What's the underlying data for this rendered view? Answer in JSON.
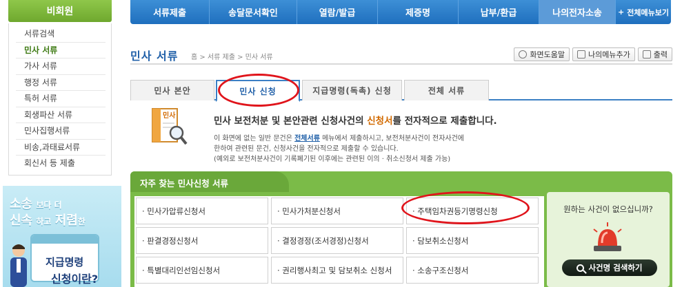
{
  "sidebar": {
    "header": "비회원",
    "items": [
      "서류검색",
      "민사 서류",
      "가사 서류",
      "행정 서류",
      "특허 서류",
      "회생파산 서류",
      "민사집행서류",
      "비송,과태료서류",
      "회신서 등 제출"
    ],
    "active_index": 1
  },
  "banner": {
    "line1_a": "소송",
    "line1_b": "보다 더",
    "line2_a": "신속",
    "line2_b": "하고",
    "line2_c": "저렴",
    "line2_d": "한",
    "line3": "지급명령",
    "line4": "신청이란?"
  },
  "topnav": {
    "items": [
      "서류제출",
      "송달문서확인",
      "열람/발급",
      "제증명",
      "납부/환급",
      "나의전자소송"
    ],
    "all_menu": "전체메뉴보기",
    "all_menu_icon": "plus-icon"
  },
  "page": {
    "title": "민사 서류",
    "breadcrumb": "홈 > 서류 제출 > 민사 서류"
  },
  "tools": {
    "help": "화면도움말",
    "add_menu": "나의메뉴추가",
    "print": "출력"
  },
  "tabs": [
    "민사 본안",
    "민사 신청",
    "지급명령(독촉) 신청",
    "전체 서류"
  ],
  "active_tab": 1,
  "doc_icon_label": "민사",
  "intro": {
    "main_a": "민사 보전처분 및 본안관련 신청사건의 ",
    "main_hl": "신청서",
    "main_b": "를 전자적으로 제출합니다.",
    "sub1_a": "이 화면에 없는 일반 문건은 ",
    "sub1_link": "전체서류",
    "sub1_b": " 메뉴에서 제출하시고, 보전처분사건이 전자사건에",
    "sub2": "한하여 관련된 문건, 신청사건을 전자적으로 제출할 수 있습니다.",
    "sub3": "(예외로 보전처분사건이 기록폐기된 이후에는 관련된 이의 · 취소신청서 제출 가능)"
  },
  "panel": {
    "title": "자주 찾는 민사신청 서류",
    "forms": [
      "· 민사가압류신청서",
      "· 민사가처분신청서",
      "· 주택임차권등기명령신청",
      "· 판결경정신청서",
      "· 결정경정(조서경정)신청서",
      "· 담보취소신청서",
      "· 특별대리인선임신청서",
      "· 권리행사최고 및 담보취소 신청서",
      "· 소송구조신청서"
    ],
    "right_question": "원하는 사건이 없으십니까?",
    "search_button": "사건명 검색하기"
  },
  "colors": {
    "nav_blue": "#1f6fbe",
    "sidebar_green": "#6fa82e",
    "panel_green": "#7bbb48",
    "highlight_red": "#e0141b",
    "title_blue": "#1f5fa8"
  }
}
